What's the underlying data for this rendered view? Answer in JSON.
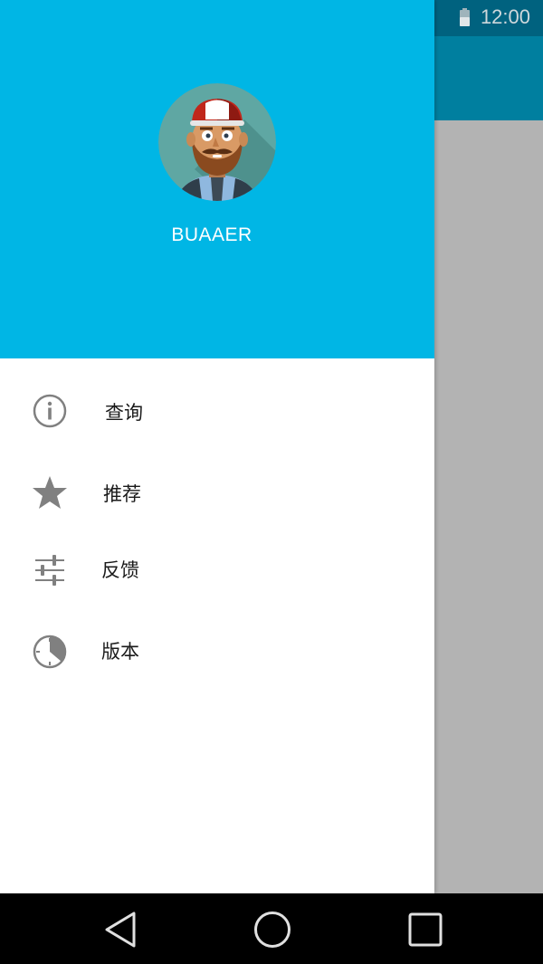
{
  "status_bar": {
    "time": "12:00",
    "battery_icon": "battery-icon"
  },
  "drawer": {
    "avatar_icon": "avatar-icon",
    "user_name": "BUAAER",
    "items": [
      {
        "label": "查询",
        "icon": "info-icon"
      },
      {
        "label": "推荐",
        "icon": "star-icon"
      },
      {
        "label": "反馈",
        "icon": "sliders-icon"
      },
      {
        "label": "版本",
        "icon": "clock-icon"
      }
    ]
  },
  "nav_bar": {
    "back_icon": "back-icon",
    "home_icon": "home-icon",
    "recents_icon": "recents-icon"
  },
  "colors": {
    "header_blue": "#00b6e5",
    "status_bar": "#00627f",
    "app_bar": "#007f9f",
    "scrim": "#b3b3b3",
    "icon_gray": "#808080"
  }
}
